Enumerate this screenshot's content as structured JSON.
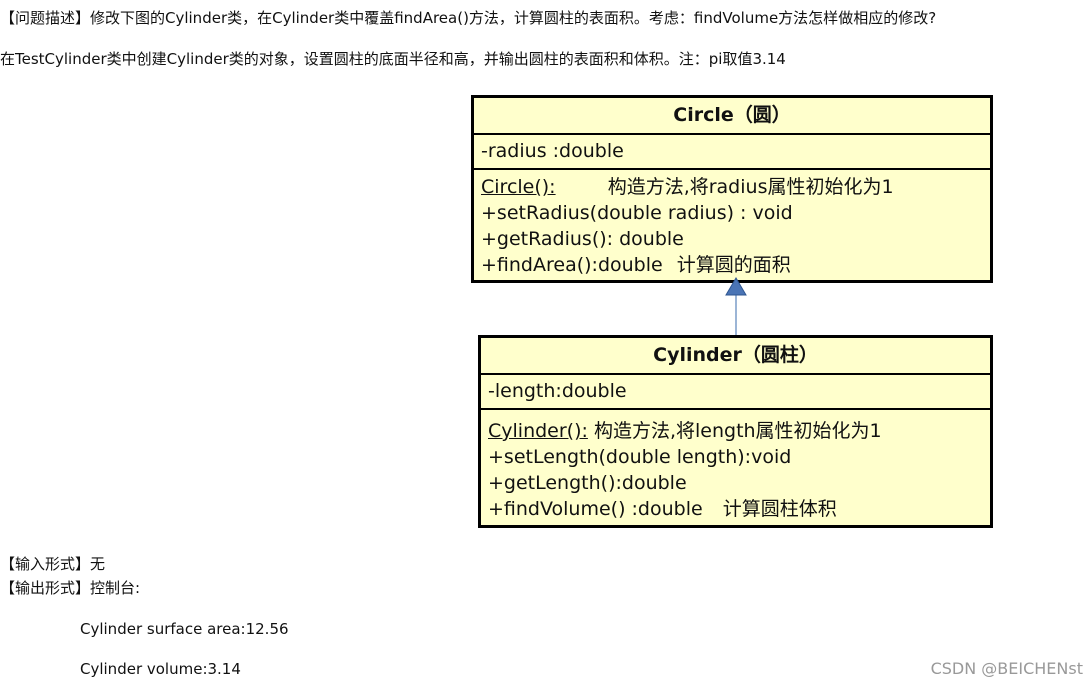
{
  "problem": {
    "line1": "【问题描述】修改下图的Cylinder类，在Cylinder类中覆盖findArea()方法，计算圆柱的表面积。考虑：findVolume方法怎样做相应的修改?",
    "line2": "在TestCylinder类中创建Cylinder类的对象，设置圆柱的底面半径和高，并输出圆柱的表面积和体积。注：pi取值3.14"
  },
  "circle": {
    "title": "Circle（圆）",
    "attr": "-radius :double",
    "ctor": "Circle():",
    "ctor_note": "构造方法,将radius属性初始化为1",
    "op1": "+setRadius(double radius) : void",
    "op2": "+getRadius(): double",
    "op3": "+findArea():double",
    "op3_note": "计算圆的面积"
  },
  "cylinder": {
    "title": "Cylinder（圆柱）",
    "attr": "-length:double",
    "ctor": "Cylinder():",
    "ctor_note": "构造方法,将length属性初始化为1",
    "op1": "+setLength(double length):void",
    "op2": "+getLength():double",
    "op3": "+findVolume() :double",
    "op3_note": "计算圆柱体积"
  },
  "input_format": "【输入形式】无",
  "output_format": "【输出形式】控制台:",
  "output_line1": "Cylinder surface area:12.56",
  "output_line2": "Cylinder volume:3.14",
  "watermark": "CSDN @BEICHENst"
}
